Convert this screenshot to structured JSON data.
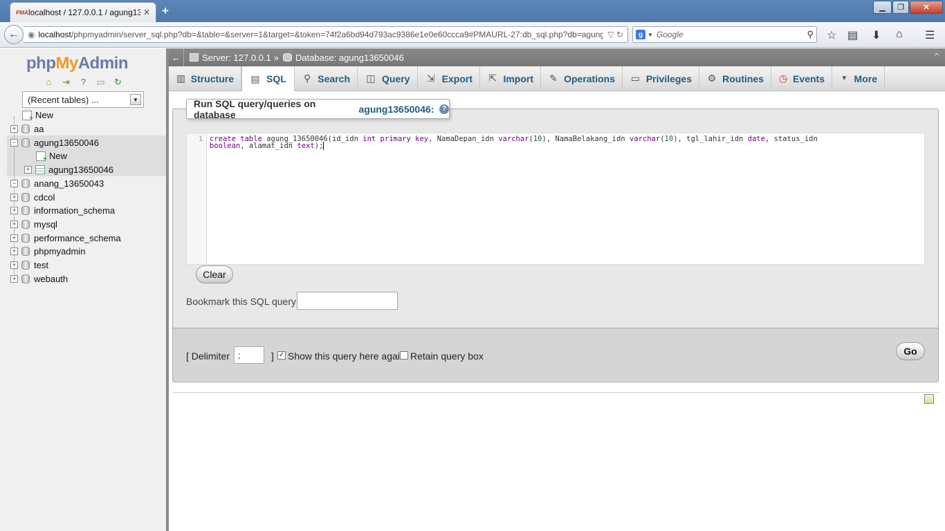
{
  "browser": {
    "tab_title": "localhost / 127.0.0.1 / agung13...",
    "tab_favicon": "PMA",
    "url_host": "localhost",
    "url_rest": "/phpmyadmin/server_sql.php?db=&table=&server=1&target=&token=74f2a6bd94d793ac9386e1e0e60ccca9#PMAURL-27:db_sql.php?db=agung",
    "search_engine": "g",
    "search_placeholder": "Google",
    "new_tab": "+",
    "close_tab": "✕"
  },
  "logo": {
    "php": "php",
    "my": "My",
    "admin": "Admin"
  },
  "recent_tables": "(Recent tables) ...",
  "tree": {
    "new_top": "New",
    "db_aa": "aa",
    "db_agung": "agung13650046",
    "agung_new": "New",
    "agung_table": "agung13650046",
    "db_anang": "anang_13650043",
    "db_cdcol": "cdcol",
    "db_information_schema": "information_schema",
    "db_mysql": "mysql",
    "db_performance_schema": "performance_schema",
    "db_phpmyadmin": "phpmyadmin",
    "db_test": "test",
    "db_webauth": "webauth"
  },
  "breadcrumb": {
    "server": "Server: 127.0.0.1",
    "separator": "»",
    "database": "Database: agung13650046"
  },
  "tabs": {
    "structure": "Structure",
    "sql": "SQL",
    "search": "Search",
    "query": "Query",
    "export": "Export",
    "import": "Import",
    "operations": "Operations",
    "privileges": "Privileges",
    "routines": "Routines",
    "events": "Events",
    "more": "More"
  },
  "sql": {
    "header_prefix": "Run SQL query/queries on database",
    "header_db": "agung13650046:",
    "line_number": "1",
    "clear_label": "Clear",
    "bookmark_label": "Bookmark this SQL query:",
    "delimiter_label": "[ Delimiter",
    "delimiter_value": ";",
    "delimiter_close": "]",
    "show_again_label": "Show this query here again",
    "retain_label": "Retain query box",
    "go_label": "Go"
  },
  "code_tokens": {
    "t1": "create table",
    "t2": " agung_13650046(id_idn ",
    "t3": "int primary key",
    "t4": ", NamaDepan_idn ",
    "t5": "varchar",
    "t6": "(",
    "t7": "10",
    "t8": "), NamaBelakang_idn ",
    "t9": "varchar",
    "t10": "(",
    "t11": "10",
    "t12": "), tgl_lahir_idn ",
    "t13": "date",
    "t14": ", status_idn\n",
    "t15": "boolean",
    "t16": ", alamat_idn ",
    "t17": "text",
    "t18": ");"
  },
  "colors": {
    "link_blue": "#235a81",
    "keyword": "#770088",
    "number": "#116644",
    "logo_orange": "#f29a23",
    "logo_blue": "#6b7ba5"
  }
}
